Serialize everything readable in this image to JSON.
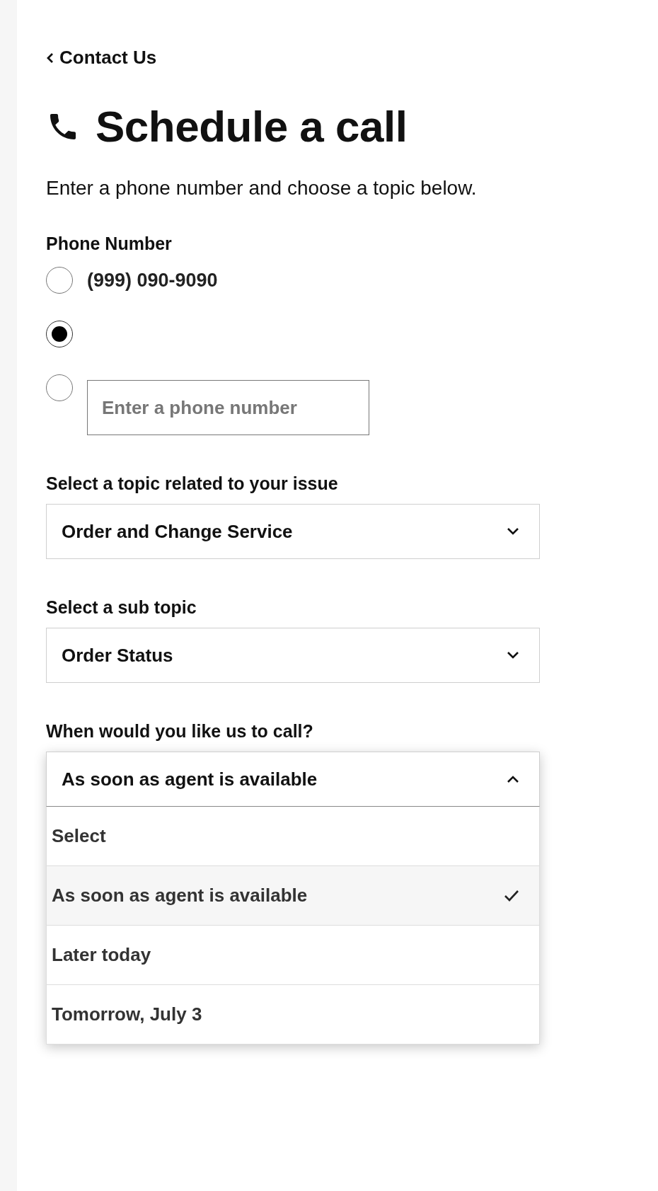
{
  "back_link": {
    "label": "Contact Us"
  },
  "title": "Schedule a call",
  "intro": "Enter a phone number and choose a topic below.",
  "phone": {
    "label": "Phone Number",
    "options": [
      {
        "kind": "number",
        "label": "(999) 090-9090",
        "selected": false
      },
      {
        "kind": "blank",
        "selected": true
      },
      {
        "kind": "input",
        "placeholder": "Enter a phone number",
        "selected": false
      }
    ]
  },
  "selects": [
    {
      "label": "Select a topic related to your issue",
      "value": "Order and Change Service",
      "expanded": false
    },
    {
      "label": "Select a sub topic",
      "value": "Order Status",
      "expanded": false
    },
    {
      "label": "When would you like us to call?",
      "value": "As soon as agent is available",
      "expanded": true,
      "options": [
        {
          "label": "Select",
          "selected": false
        },
        {
          "label": "As soon as agent is available",
          "selected": true
        },
        {
          "label": "Later today",
          "selected": false
        },
        {
          "label": "Tomorrow, July 3",
          "selected": false
        }
      ]
    }
  ]
}
